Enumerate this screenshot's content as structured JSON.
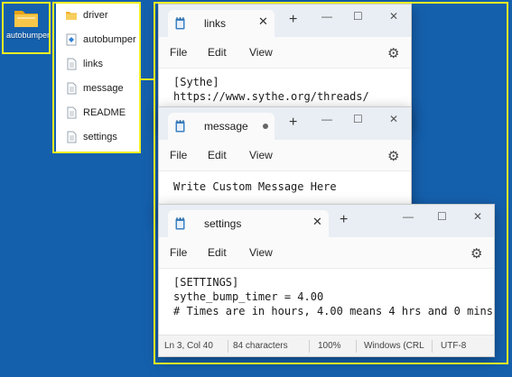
{
  "desktop": {
    "icon_label": "autobumper"
  },
  "explorer": {
    "files": [
      {
        "name": "driver",
        "icon": "folder-icon"
      },
      {
        "name": "autobumper",
        "icon": "app-icon"
      },
      {
        "name": "links",
        "icon": "text-file-icon"
      },
      {
        "name": "message",
        "icon": "text-file-icon"
      },
      {
        "name": "README",
        "icon": "text-file-icon"
      },
      {
        "name": "settings",
        "icon": "text-file-icon"
      }
    ]
  },
  "menu": {
    "file": "File",
    "edit": "Edit",
    "view": "View"
  },
  "windows": {
    "links": {
      "tab_title": "links",
      "lines": [
        "[Sythe]",
        "https://www.sythe.org/threads/"
      ]
    },
    "message": {
      "tab_title": "message",
      "lines": [
        "Write Custom Message Here"
      ]
    },
    "settings": {
      "tab_title": "settings",
      "lines": [
        "[SETTINGS]",
        "sythe_bump_timer = 4.00",
        "# Times are in hours, 4.00 means 4 hrs and 0 mins"
      ],
      "status": {
        "position": "Ln 3, Col 40",
        "chars": "84 characters",
        "zoom": "100%",
        "line_ending": "Windows (CRL",
        "encoding": "UTF-8"
      }
    }
  },
  "colors": {
    "desktop": "#1560ad",
    "highlight": "#f2ee24",
    "tabbar": "#e9eef4",
    "notepad_icon": "#3b82c4"
  }
}
